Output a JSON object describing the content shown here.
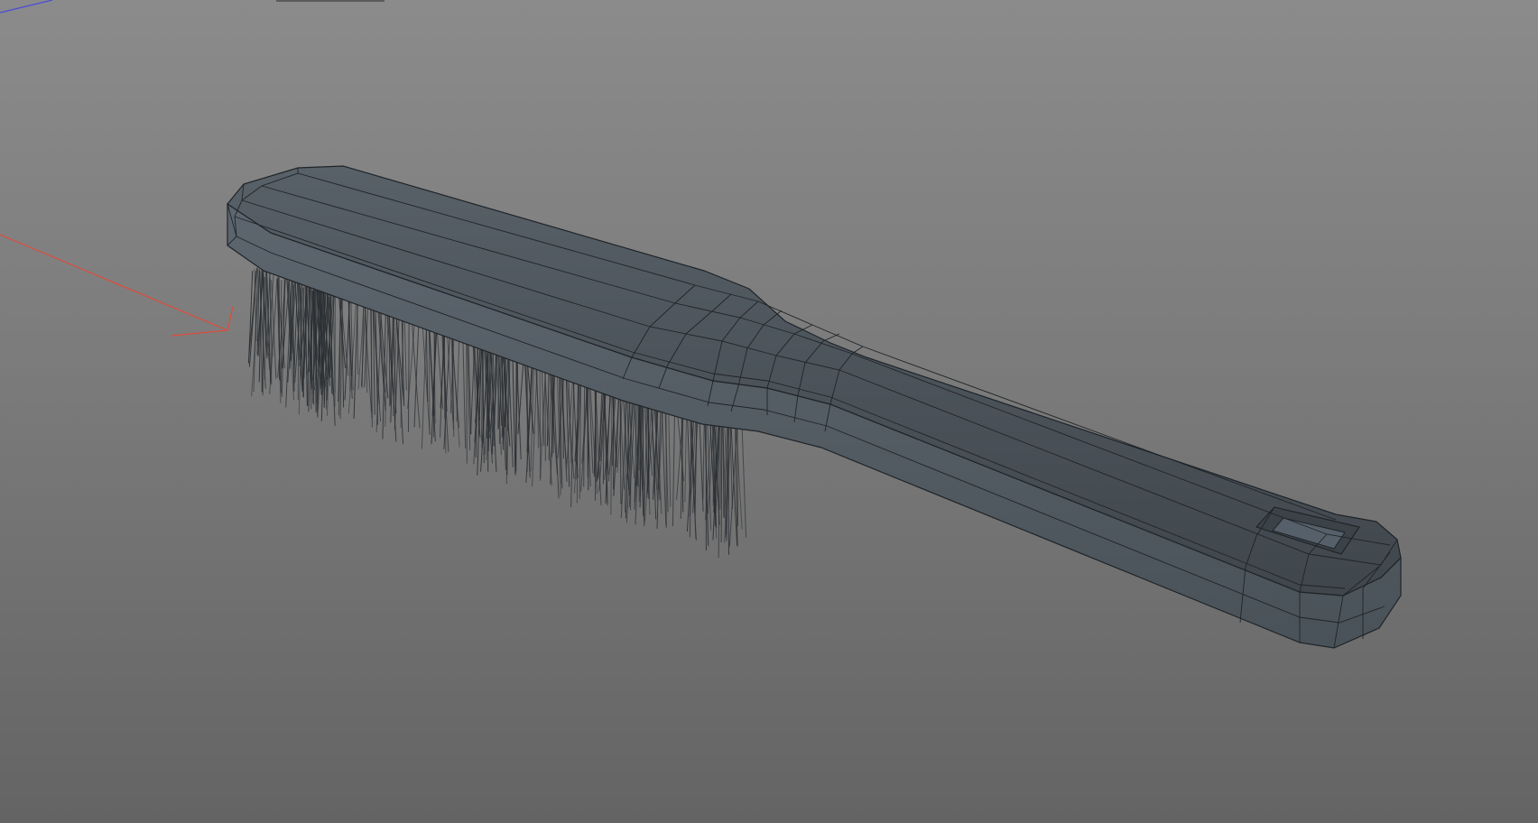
{
  "viewport": {
    "mode": "perspective",
    "background_top": "#8b8b8b",
    "background_bottom": "#646464"
  },
  "axis_gizmo": {
    "x_axis_color": "#e04b3a",
    "z_axis_color": "#4a4ad8"
  },
  "scene_object": {
    "type": "brush",
    "body_color": "#4e565d",
    "wire_color": "#1f2428",
    "bristle_color": "#2b2f33"
  }
}
